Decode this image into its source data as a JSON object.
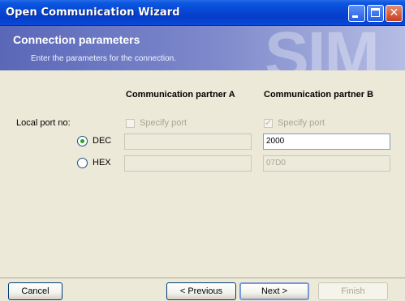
{
  "window": {
    "title": "Open Communication Wizard"
  },
  "banner": {
    "heading": "Connection parameters",
    "subtitle": "Enter the parameters for the connection.",
    "watermark": "SIM"
  },
  "form": {
    "col_a_header": "Communication partner A",
    "col_b_header": "Communication partner B",
    "local_port_label": "Local port no:",
    "specify_port_label": "Specify port",
    "partner_a_specify_checked": false,
    "partner_b_specify_checked": true,
    "radio_dec_label": "DEC",
    "radio_hex_label": "HEX",
    "selected_radio": "DEC",
    "partner_a_dec_value": "",
    "partner_a_hex_value": "",
    "partner_b_dec_value": "2000",
    "partner_b_hex_value": "07D0"
  },
  "buttons": {
    "cancel": "Cancel",
    "previous": "< Previous",
    "next": "Next >",
    "finish": "Finish"
  }
}
